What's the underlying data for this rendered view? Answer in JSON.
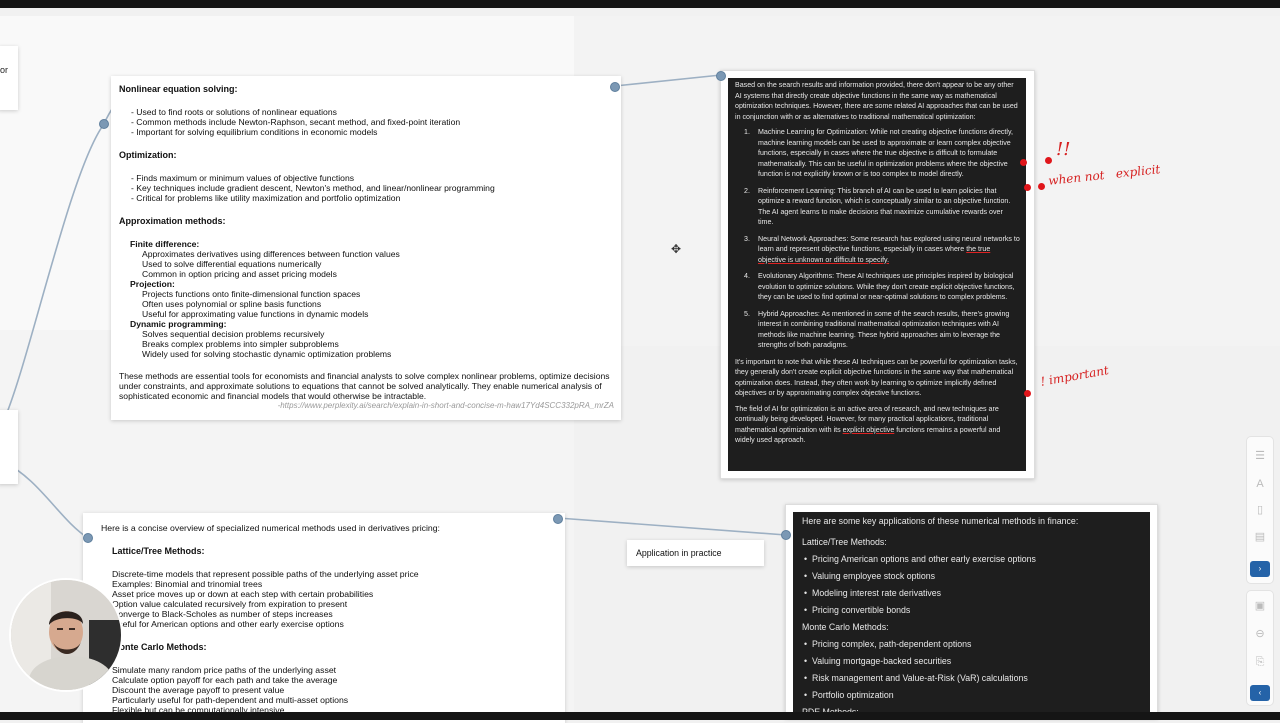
{
  "left_stub": {
    "text": "or"
  },
  "card1": {
    "h1": "Nonlinear equation solving:",
    "b1": [
      "- Used to find roots or solutions of nonlinear equations",
      "- Common methods include Newton-Raphson, secant method, and fixed-point iteration",
      "- Important for solving equilibrium conditions in economic models"
    ],
    "h2": "Optimization:",
    "b2": [
      "- Finds maximum or minimum values of objective functions",
      "- Key techniques include gradient descent, Newton's method, and linear/nonlinear programming",
      "- Critical for problems like utility maximization and portfolio optimization"
    ],
    "h3": "Approximation methods:",
    "fd_h": "Finite difference:",
    "fd": [
      "Approximates derivatives using differences between function values",
      "Used to solve differential equations numerically",
      "Common in option pricing and asset pricing models"
    ],
    "proj_h": "Projection:",
    "proj": [
      "Projects functions onto finite-dimensional function spaces",
      "Often uses polynomial or spline basis functions",
      "Useful for approximating value functions in dynamic models"
    ],
    "dp_h": "Dynamic programming:",
    "dp": [
      "Solves sequential decision problems recursively",
      "Breaks complex problems into simpler subproblems",
      "Widely used for solving stochastic dynamic optimization problems"
    ],
    "summary": "These methods are essential tools for economists and financial analysts to solve complex nonlinear problems, optimize decisions under constraints, and approximate solutions to equations that cannot be solved analytically. They enable numerical analysis of sophisticated economic and financial models that would otherwise be intractable.",
    "url": "-https://www.perplexity.ai/search/explain-in-short-and-concise-m-haw17Yd4SCC332pRA_mrZA"
  },
  "card2": {
    "intro": "Based on the search results and information provided, there don't appear to be any other AI systems that directly create objective functions in the same way as mathematical optimization techniques. However, there are some related AI approaches that can be used in conjunction with or as alternatives to traditional mathematical optimization:",
    "items": [
      {
        "num": "1.",
        "text": "Machine Learning for Optimization: While not creating objective functions directly, machine learning models can be used to approximate or learn complex objective functions, especially in cases where the true objective is difficult to formulate mathematically. This can be useful in optimization problems where the objective function is not explicitly known or is too complex to model directly."
      },
      {
        "num": "2.",
        "text_a": "Reinforcement Learning: This branch of AI can be used to learn policies that optimize a reward function, which is conceptually similar to an objective function. ",
        "text_u": "The AI agent learns to make decisions that maximize cumulative rewards over time.",
        "text_b": ""
      },
      {
        "num": "3.",
        "text_a": "Neural Network Approaches: Some research has explored using neural networks to learn and represent objective functions, especially in cases where ",
        "text_u": "the true objective is unknown or difficult to specify.",
        "text_b": ""
      },
      {
        "num": "4.",
        "text": "Evolutionary Algorithms: These AI techniques use principles inspired by biological evolution to optimize solutions. While they don't create explicit objective functions, they can be used to find optimal or near-optimal solutions to complex problems."
      },
      {
        "num": "5.",
        "text": "Hybrid Approaches: As mentioned in some of the search results, there's growing interest in combining traditional mathematical optimization techniques with AI methods like machine learning. These hybrid approaches aim to leverage the strengths of both paradigms."
      }
    ],
    "p2": "It's important to note that while these AI techniques can be powerful for optimization tasks, they generally don't create explicit objective functions in the same way that mathematical optimization does. Instead, they often work by learning to optimize implicitly defined objectives or by approximating complex objective functions.",
    "p3_a": "The field of AI for optimization is an active area of research, and new techniques are continually being developed. However, for many practical applications, traditional mathematical optimization with its ",
    "p3_u": "explicit objective",
    "p3_b": " functions remains a powerful and widely used approach."
  },
  "annotations": {
    "excl": "!!",
    "when_not": "when not   explicit",
    "important": "important"
  },
  "card3": {
    "intro": "Here is a concise overview of specialized numerical methods used in derivatives pricing:",
    "h1": "Lattice/Tree Methods:",
    "l1": [
      "Discrete-time models that represent possible paths of the underlying asset price",
      "Examples: Binomial and trinomial trees",
      "Asset price moves up or down at each step with certain probabilities",
      "Option value calculated recursively from expiration to present",
      "Converge to Black-Scholes as number of steps increases",
      "Useful for American options and other early exercise options"
    ],
    "h2": "Monte Carlo Methods:",
    "l2": [
      "Simulate many random price paths of the underlying asset",
      "Calculate option payoff for each path and take the average",
      "Discount the average payoff to present value",
      "Particularly useful for path-dependent and multi-asset options",
      "Flexible but can be computationally intensive"
    ]
  },
  "card4": {
    "label": "Application in practice"
  },
  "card5": {
    "intro": "Here are some key applications of these numerical methods in finance:",
    "h1": "Lattice/Tree Methods:",
    "l1": [
      "Pricing American options and other early exercise options",
      "Valuing employee stock options",
      "Modeling interest rate derivatives",
      "Pricing convertible bonds"
    ],
    "h2": "Monte Carlo Methods:",
    "l2": [
      "Pricing complex, path-dependent options",
      "Valuing mortgage-backed securities",
      "Risk management and Value-at-Risk (VaR) calculations",
      "Portfolio optimization"
    ],
    "h3": "PDE Methods:"
  },
  "colors": {
    "connector": "#7b98b4",
    "annotation_red": "#d61f1f",
    "dark_bg": "#1e1e1e",
    "tool_accent": "#2563a8"
  },
  "icons": [
    "align-icon",
    "text-icon",
    "page-icon",
    "page-edit-icon",
    "arrow-right-icon",
    "image-icon",
    "zoom-out-icon",
    "export-icon",
    "arrow-left-icon",
    "move-cursor-icon"
  ]
}
